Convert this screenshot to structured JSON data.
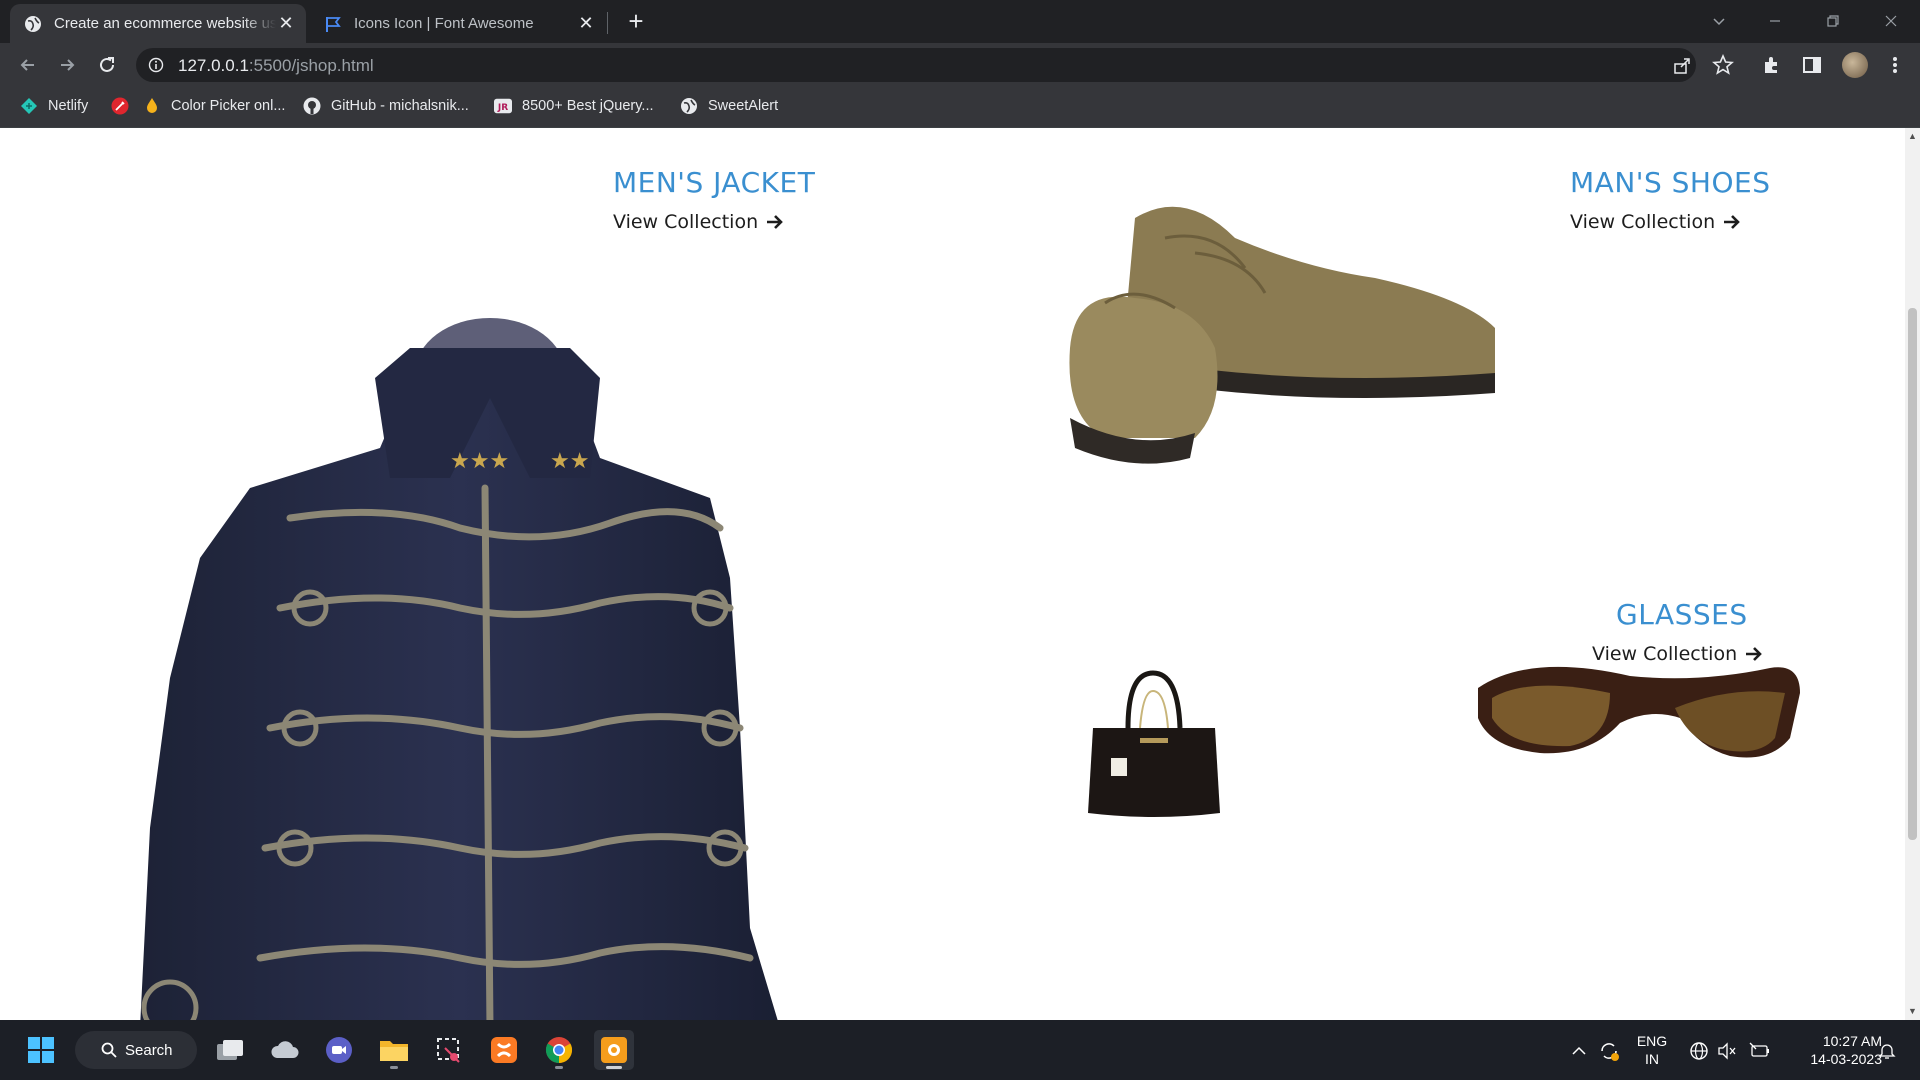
{
  "browser": {
    "tabs": [
      {
        "title": "Create an ecommerce website us",
        "active": true,
        "favicon": "globe-icon"
      },
      {
        "title": "Icons Icon | Font Awesome",
        "active": false,
        "favicon": "flag-icon"
      }
    ],
    "url_host": "127.0.0.1",
    "url_path": ":5500/jshop.html",
    "bookmarks": [
      {
        "label": "Netlify",
        "icon": "netlify-icon"
      },
      {
        "label": "",
        "icon": "red-pen-icon"
      },
      {
        "label": "Color Picker onl...",
        "icon": "color-picker-icon"
      },
      {
        "label": "GitHub - michalsnik...",
        "icon": "github-icon"
      },
      {
        "label": "8500+ Best jQuery...",
        "icon": "jr-icon"
      },
      {
        "label": "SweetAlert",
        "icon": "globe-icon"
      }
    ]
  },
  "page": {
    "collections": {
      "jacket": {
        "title": "MEN'S JACKET",
        "link": "View Collection"
      },
      "shoes": {
        "title": "MAN'S SHOES",
        "link": "View Collection"
      },
      "glasses": {
        "title": "GLASSES",
        "link": "View Collection"
      }
    }
  },
  "taskbar": {
    "search_label": "Search",
    "lang_top": "ENG",
    "lang_bottom": "IN",
    "time": "10:27 AM",
    "date": "14-03-2023"
  },
  "colors": {
    "accent": "#3a8fd0",
    "chrome_dark": "#202124",
    "chrome_mid": "#35363a",
    "taskbar": "#1c1f26"
  }
}
